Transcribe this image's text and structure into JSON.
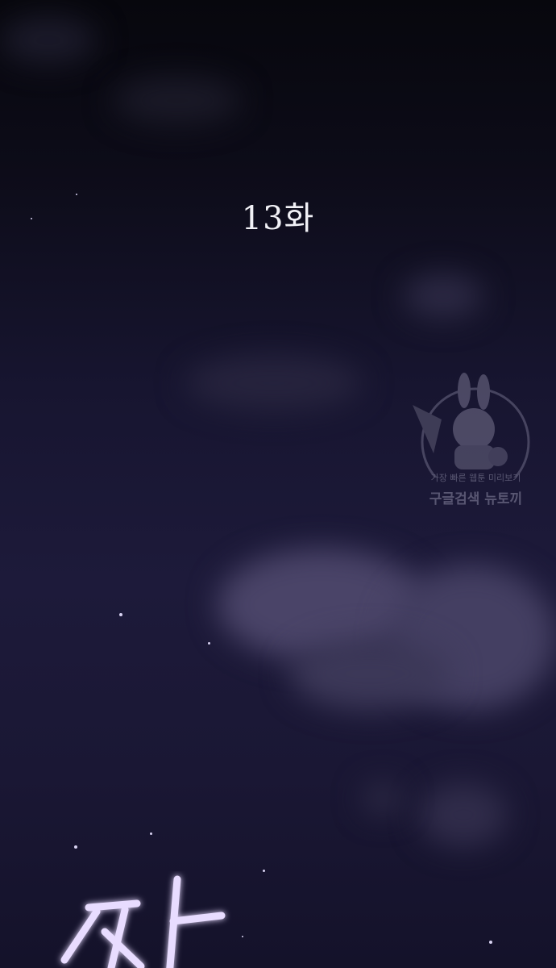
{
  "episode": {
    "title": "13화"
  },
  "watermark": {
    "line1": "가장 빠른 웹툰 미리보기",
    "line2": "구글검색 뉴토끼"
  },
  "sound_effect": {
    "text": "짜"
  },
  "colors": {
    "sky_top": "#07070d",
    "sky_bottom": "#1d1a3a",
    "cloud": "#4a4468",
    "text": "#f1f1f6",
    "sfx_glow": "#c9a8ff"
  }
}
